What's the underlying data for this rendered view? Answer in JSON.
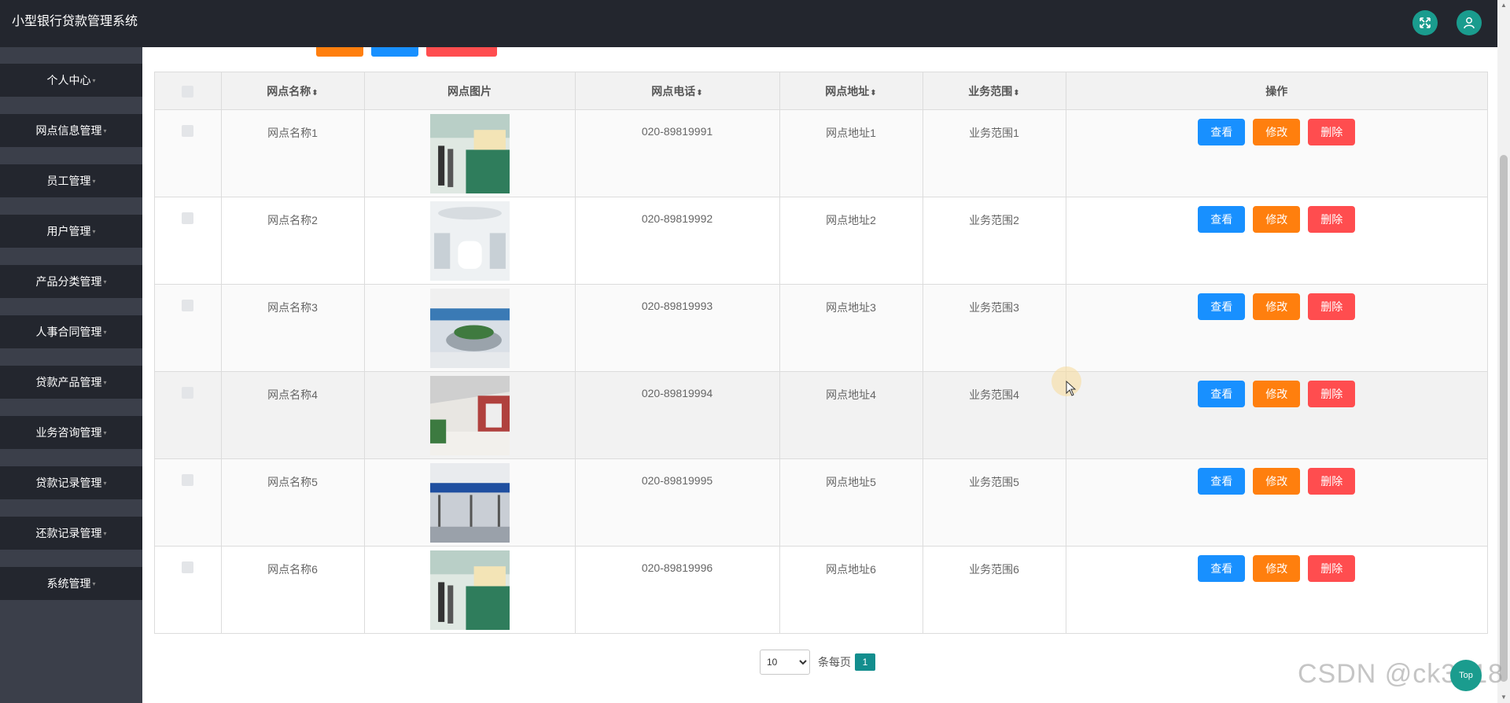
{
  "app": {
    "title": "小型银行贷款管理系统"
  },
  "header": {
    "fullscreen_icon": "expand-arrows-icon",
    "user_icon": "user-icon",
    "accent": "#1a9c8e"
  },
  "sidebar": {
    "items": [
      {
        "label": "个人中心"
      },
      {
        "label": "网点信息管理"
      },
      {
        "label": "员工管理"
      },
      {
        "label": "用户管理"
      },
      {
        "label": "产品分类管理"
      },
      {
        "label": "人事合同管理"
      },
      {
        "label": "贷款产品管理"
      },
      {
        "label": "业务咨询管理"
      },
      {
        "label": "贷款记录管理"
      },
      {
        "label": "还款记录管理"
      },
      {
        "label": "系统管理"
      }
    ]
  },
  "table": {
    "columns": [
      "网点名称",
      "网点图片",
      "网点电话",
      "网点地址",
      "业务范围",
      "操作"
    ],
    "rows": [
      {
        "name": "网点名称1",
        "phone": "020-89819991",
        "address": "网点地址1",
        "scope": "业务范围1"
      },
      {
        "name": "网点名称2",
        "phone": "020-89819992",
        "address": "网点地址2",
        "scope": "业务范围2"
      },
      {
        "name": "网点名称3",
        "phone": "020-89819993",
        "address": "网点地址3",
        "scope": "业务范围3"
      },
      {
        "name": "网点名称4",
        "phone": "020-89819994",
        "address": "网点地址4",
        "scope": "业务范围4"
      },
      {
        "name": "网点名称5",
        "phone": "020-89819995",
        "address": "网点地址5",
        "scope": "业务范围5"
      },
      {
        "name": "网点名称6",
        "phone": "020-89819996",
        "address": "网点地址6",
        "scope": "业务范围6"
      }
    ],
    "actions": {
      "view": "查看",
      "edit": "修改",
      "delete": "删除"
    }
  },
  "pagination": {
    "page_size": "10",
    "per_page_label": "条每页",
    "current_page": "1"
  },
  "to_top": {
    "label": "Top"
  },
  "watermark": "CSDN @ck3018"
}
